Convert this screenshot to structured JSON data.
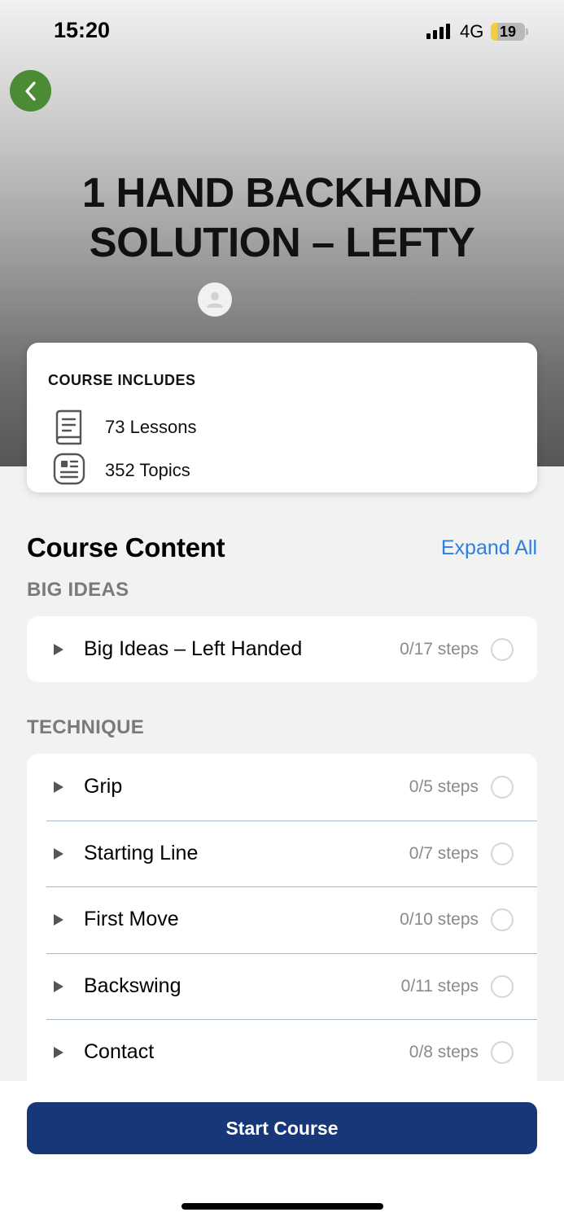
{
  "status_bar": {
    "time": "15:20",
    "network": "4G",
    "battery_level": "19",
    "icons": [
      "signal-icon",
      "battery-icon"
    ]
  },
  "header": {
    "back_icon": "chevron-left-icon",
    "title": "1 HAND BACKHAND SOLUTION – LEFTY",
    "avatar_icon": "user-icon"
  },
  "course_includes": {
    "heading": "COURSE INCLUDES",
    "items": [
      {
        "icon": "book-icon",
        "label": "73 Lessons"
      },
      {
        "icon": "document-icon",
        "label": "352 Topics"
      }
    ]
  },
  "course_content": {
    "heading": "Course Content",
    "expand_all": "Expand All",
    "sections": [
      {
        "title": "BIG IDEAS",
        "lessons": [
          {
            "name": "Big Ideas – Left Handed",
            "steps": "0/17 steps"
          }
        ]
      },
      {
        "title": "TECHNIQUE",
        "lessons": [
          {
            "name": "Grip",
            "steps": "0/5 steps"
          },
          {
            "name": "Starting Line",
            "steps": "0/7 steps"
          },
          {
            "name": "First Move",
            "steps": "0/10 steps"
          },
          {
            "name": "Backswing",
            "steps": "0/11 steps"
          },
          {
            "name": "Contact",
            "steps": "0/8 steps"
          }
        ]
      }
    ]
  },
  "footer": {
    "start_button": "Start Course"
  },
  "colors": {
    "accent_green": "#4a8b33",
    "link_blue": "#2f7fe0",
    "primary_button": "#173778"
  }
}
